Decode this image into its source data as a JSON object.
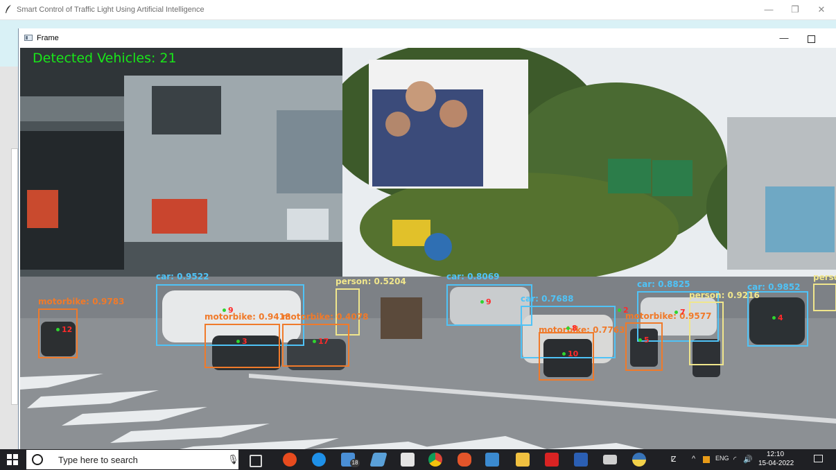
{
  "app": {
    "title": "Smart Control of Traffic Light Using Artificial Intelligence",
    "minimize_label": "—",
    "restore_label": "❐",
    "close_label": "✕"
  },
  "frame": {
    "title": "Frame",
    "minimize_label": "—",
    "detected_text": "Detected Vehicles: 21",
    "detections": [
      {
        "label": "car: 0.9522",
        "color": "#4fc3f7"
      },
      {
        "label": "car: 0.8069",
        "color": "#4fc3f7"
      },
      {
        "label": "car: 0.7688",
        "color": "#4fc3f7"
      },
      {
        "label": "car: 0.8825",
        "color": "#4fc3f7"
      },
      {
        "label": "car: 0.9852",
        "color": "#4fc3f7"
      },
      {
        "label": "person: 0.5204",
        "color": "#f0e68c"
      },
      {
        "label": "person: 0.9216",
        "color": "#f0e68c"
      },
      {
        "label": "perso",
        "color": "#f0e68c"
      },
      {
        "label": "motorbike: 0.9783",
        "color": "#f07a2a"
      },
      {
        "label": "motorbike: 0.9418",
        "color": "#f07a2a"
      },
      {
        "label": "motorbike: 0.4078",
        "color": "#f07a2a"
      },
      {
        "label": "motorbike: 0.7763",
        "color": "#f07a2a"
      },
      {
        "label": "motorbike: 0.9577",
        "color": "#f07a2a"
      }
    ],
    "track_ids": [
      "12",
      "3",
      "17",
      "8",
      "10",
      "5",
      "4",
      "9",
      "7",
      "9",
      "2"
    ]
  },
  "taskbar": {
    "search_placeholder": "Type here to search",
    "mail_badge": "18",
    "time": "12:10",
    "date": "15-04-2022",
    "tray_lang": "ENG"
  },
  "colors": {
    "car": "#4fc3f7",
    "person": "#f0e68c",
    "motorbike": "#f07a2a",
    "count_text": "#19e619",
    "taskbar": "#1f2024"
  },
  "icons": [
    "start-windows-icon",
    "search-icon",
    "microphone-icon",
    "task-view-icon",
    "cortana-icon",
    "edge-icon",
    "mail-icon",
    "photos-icon",
    "store-icon",
    "chrome-icon",
    "paint-icon",
    "file-icon",
    "explorer-icon",
    "acrobat-icon",
    "word-icon",
    "terminal-icon",
    "python-icon"
  ]
}
